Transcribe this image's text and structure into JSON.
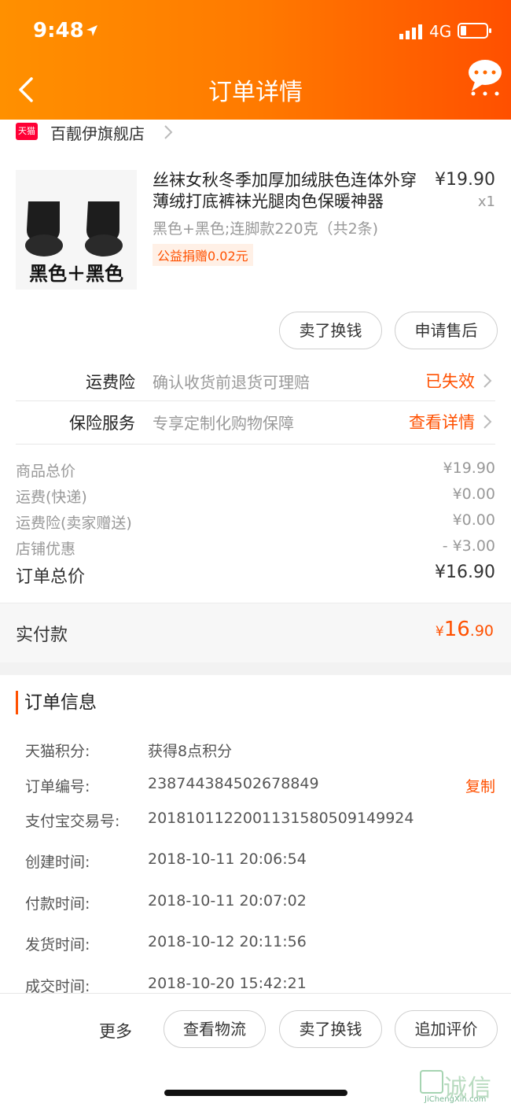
{
  "status_bar": {
    "time": "9:48",
    "network": "4G"
  },
  "nav": {
    "title": "订单详情"
  },
  "shop": {
    "badge": "天猫",
    "name": "百靓伊旗舰店"
  },
  "product": {
    "title": "丝袜女秋冬季加厚加绒肤色连体外穿薄绒打底裤袜光腿肉色保暖神器",
    "price": "¥19.90",
    "qty": "x1",
    "sku": "黑色+黑色;连脚款220克（共2条)",
    "charity": "公益捐赠0.02元",
    "image_caption": "黑色＋黑色"
  },
  "item_actions": [
    "卖了换钱",
    "申请售后"
  ],
  "services": [
    {
      "label": "运费险",
      "desc": "确认收货前退货可理赔",
      "status": "已失效"
    },
    {
      "label": "保险服务",
      "desc": "专享定制化购物保障",
      "status": "查看详情"
    }
  ],
  "summary": [
    {
      "label": "商品总价",
      "value": "¥19.90"
    },
    {
      "label": "运费(快递)",
      "value": "¥0.00"
    },
    {
      "label": "运费险(卖家赠送)",
      "value": "¥0.00"
    },
    {
      "label": "店铺优惠",
      "value": "- ¥3.00"
    }
  ],
  "order_total": {
    "label": "订单总价",
    "value": "¥16.90"
  },
  "paid": {
    "label": "实付款",
    "currency": "¥",
    "integer": "16",
    "decimal": ".90"
  },
  "order_info": {
    "heading": "订单信息",
    "rows": [
      {
        "label": "天猫积分:",
        "value": "获得8点积分"
      },
      {
        "label": "订单编号:",
        "value": "238744384502678849",
        "action": "复制"
      },
      {
        "label": "支付宝交易号:",
        "value": "2018101122001131580509149924"
      },
      {
        "label": "创建时间:",
        "value": "2018-10-11 20:06:54"
      },
      {
        "label": "付款时间:",
        "value": "2018-10-11 20:07:02"
      },
      {
        "label": "发货时间:",
        "value": "2018-10-12 20:11:56"
      },
      {
        "label": "成交时间:",
        "value": "2018-10-20 15:42:21"
      }
    ]
  },
  "bottom_actions": {
    "more": "更多",
    "buttons": [
      "查看物流",
      "卖了换钱",
      "追加评价"
    ]
  },
  "watermark": {
    "text": "诚信",
    "url": "JiChengXin.com"
  },
  "colors": {
    "accent": "#ff5000",
    "header_start": "#ff9000",
    "header_end": "#ff5000",
    "tmall": "#ff0036"
  },
  "icons": [
    "location-arrow-icon",
    "signal-icon",
    "battery-icon",
    "back-icon",
    "more-bubble-icon",
    "chevron-right-icon",
    "tmall-icon"
  ]
}
